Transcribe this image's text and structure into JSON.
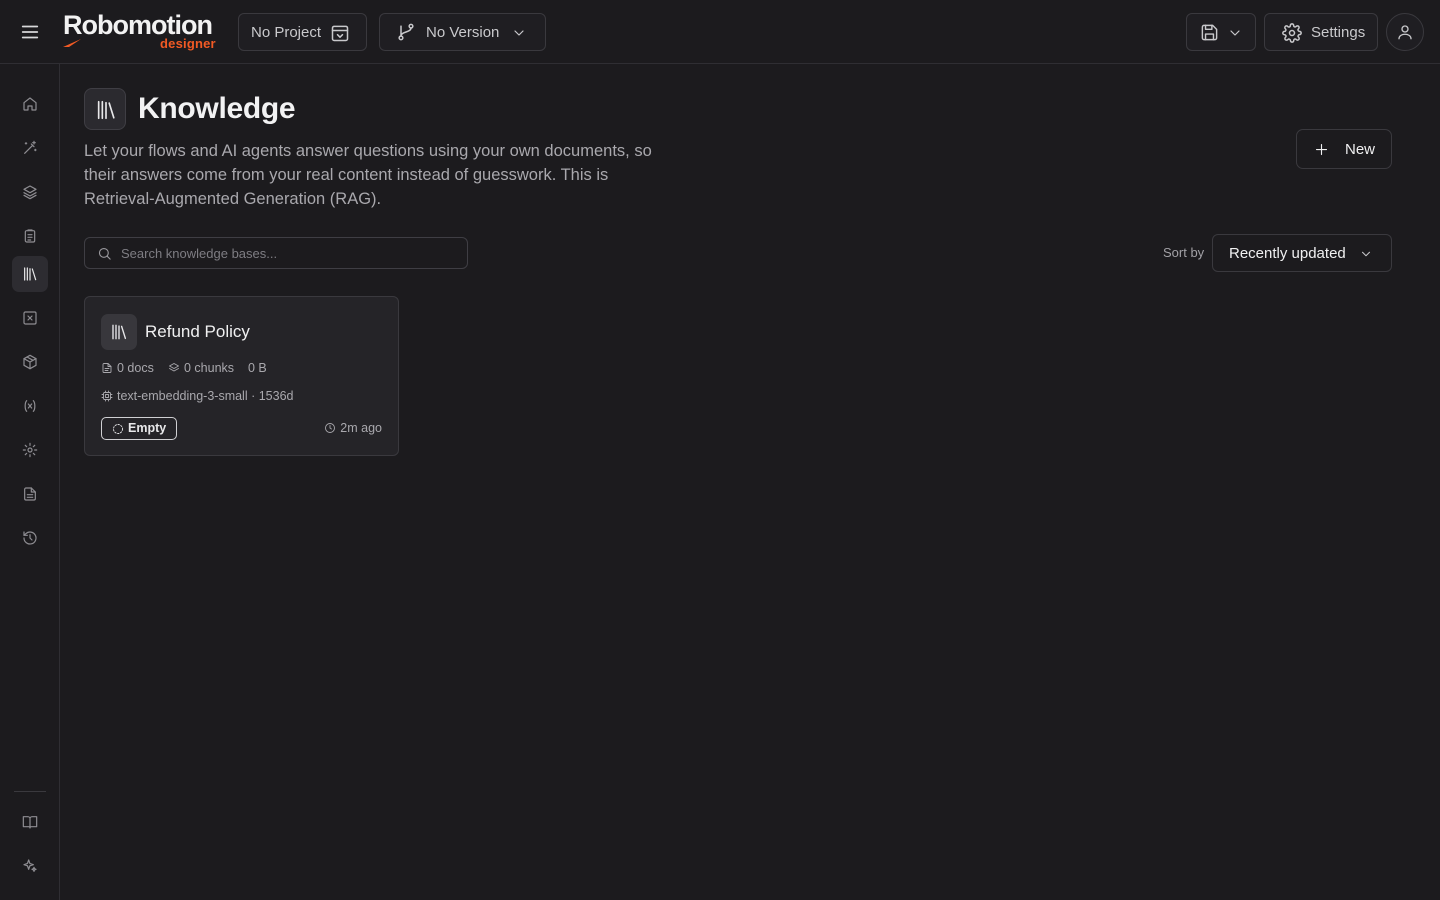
{
  "app": {
    "logo_text": "Robomotion",
    "logo_subtext": "designer"
  },
  "topbar": {
    "project_label": "No Project",
    "version_label": "No Version",
    "settings_label": "Settings"
  },
  "sidebar": {
    "items": [
      {
        "icon": "home-icon"
      },
      {
        "icon": "magic-wand-icon"
      },
      {
        "icon": "layers-icon"
      },
      {
        "icon": "clipboard-icon"
      },
      {
        "icon": "library-icon",
        "active": true
      },
      {
        "icon": "x-box-icon"
      },
      {
        "icon": "package-icon"
      },
      {
        "icon": "variable-icon"
      },
      {
        "icon": "gear-icon"
      },
      {
        "icon": "file-text-icon"
      },
      {
        "icon": "history-icon"
      }
    ],
    "bottom": [
      {
        "icon": "book-open-icon"
      },
      {
        "icon": "sparkles-icon"
      }
    ]
  },
  "page": {
    "title": "Knowledge",
    "description": "Let your flows and AI agents answer questions using your own documents, so their answers come from your real content instead of guesswork. This is Retrieval-Augmented Generation (RAG).",
    "new_button": "New"
  },
  "search": {
    "placeholder": "Search knowledge bases...",
    "value": ""
  },
  "sort": {
    "label": "Sort by",
    "selected": "Recently updated"
  },
  "knowledge_bases": [
    {
      "name": "Refund Policy",
      "docs": "0 docs",
      "chunks": "0 chunks",
      "size": "0 B",
      "model": "text-embedding-3-small · 1536d",
      "status": "Empty",
      "updated": "2m ago"
    }
  ],
  "colors": {
    "background": "#1c1b1e",
    "border": "#3a393e",
    "brand_accent": "#f15a24",
    "card": "#252428"
  }
}
